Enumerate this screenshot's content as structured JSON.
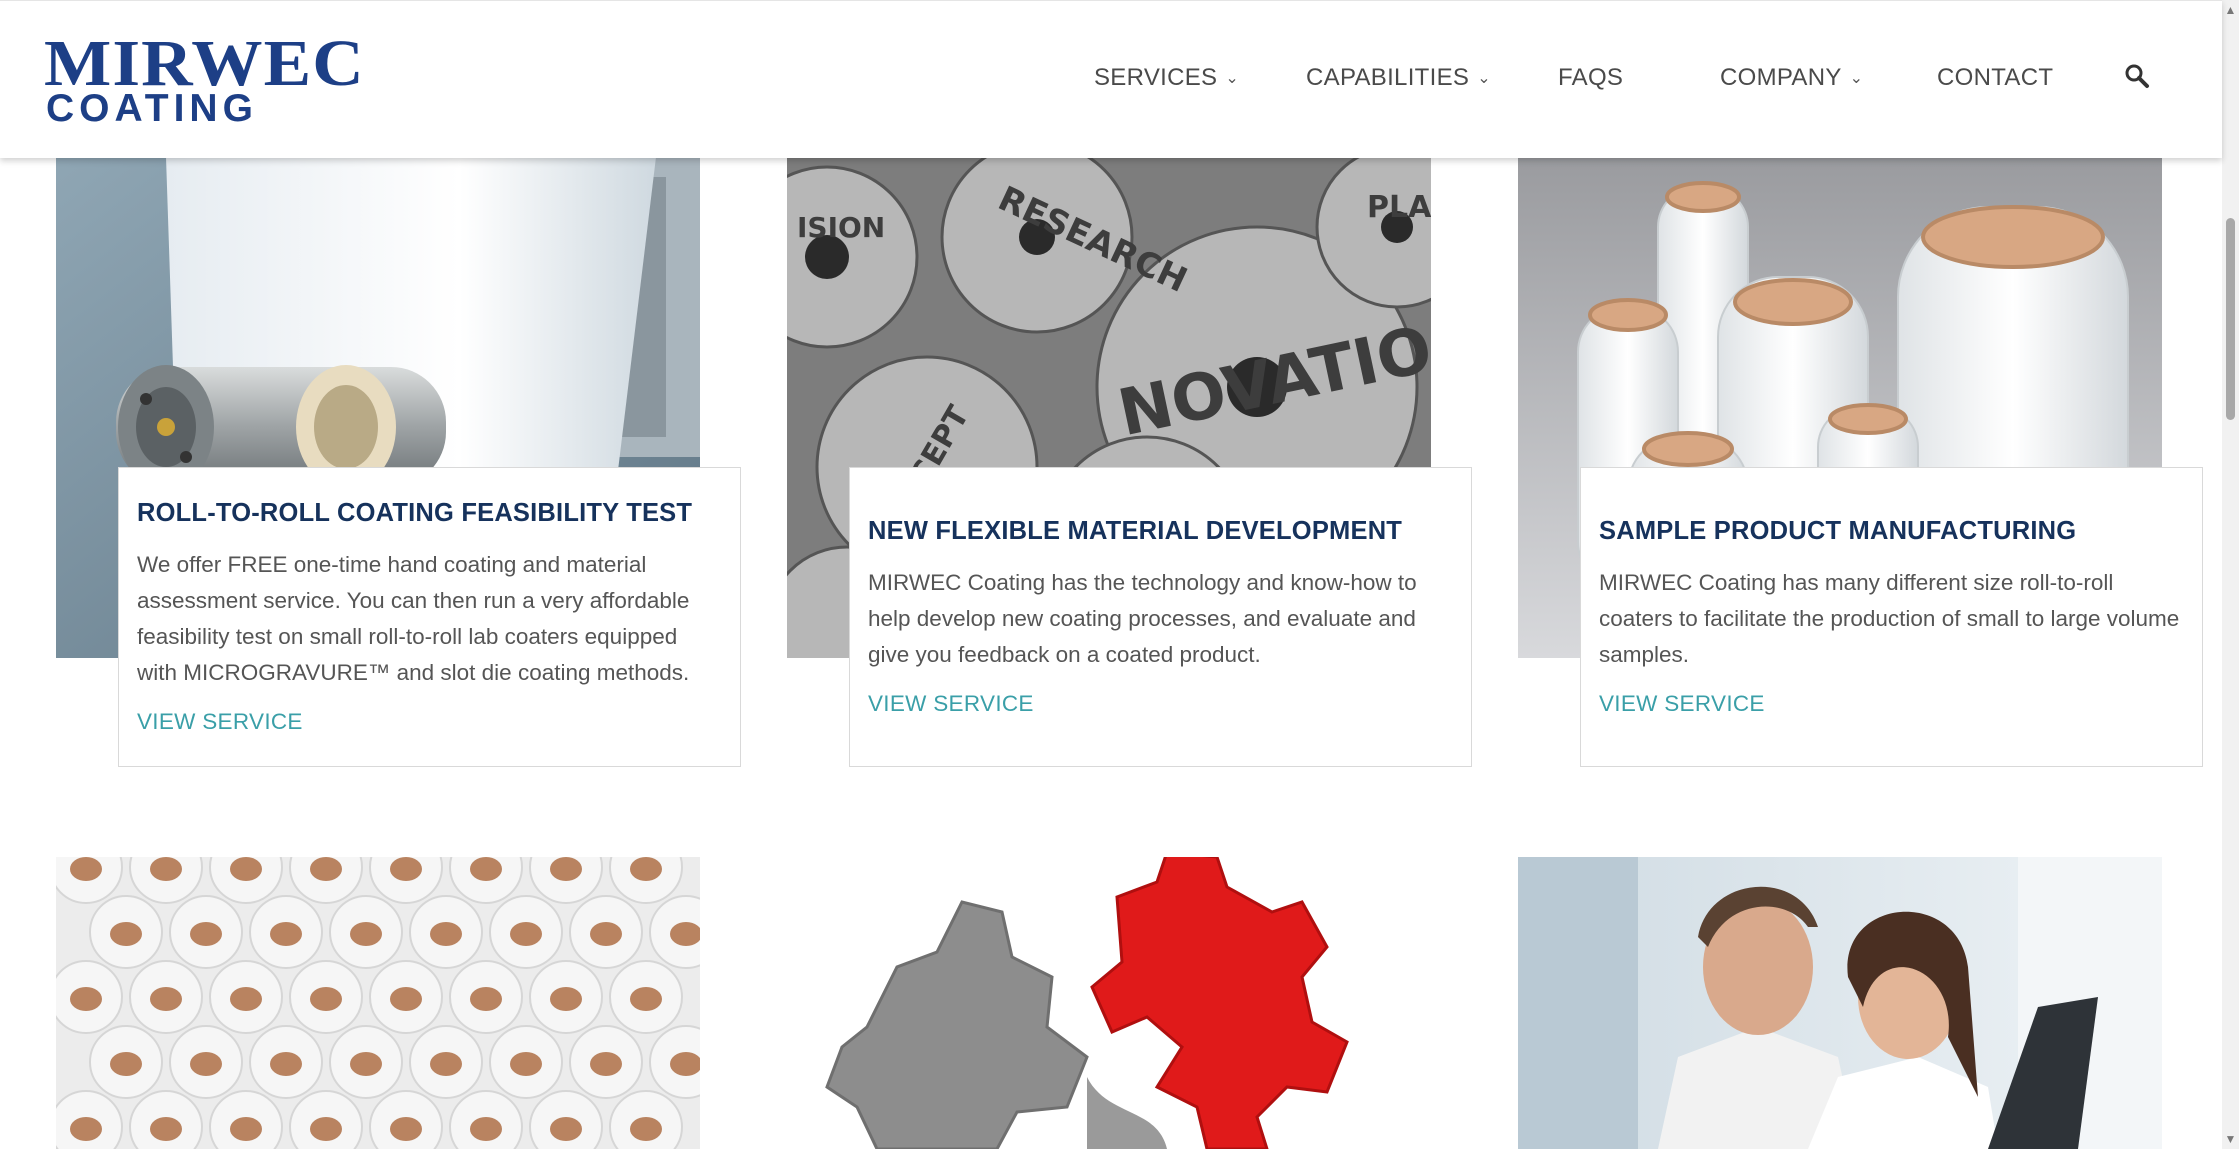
{
  "brand": {
    "line1": "MIRWEC",
    "line2": "COATING",
    "color": "#1d3f86"
  },
  "nav": {
    "items": [
      {
        "label": "SERVICES",
        "has_dropdown": true
      },
      {
        "label": "CAPABILITIES",
        "has_dropdown": true
      },
      {
        "label": "FAQS",
        "has_dropdown": false
      },
      {
        "label": "COMPANY",
        "has_dropdown": true
      },
      {
        "label": "CONTACT",
        "has_dropdown": false
      }
    ],
    "dropdown_glyph": "⌄",
    "search_icon": "search-icon"
  },
  "services": [
    {
      "title": "ROLL-TO-ROLL COATING FEASIBILITY TEST",
      "description": "We offer FREE one-time hand coating and material assessment service. You can then run a very affordable feasibility test on small roll-to-roll lab coaters equipped with MICROGRAVURE™ and slot die coating methods.",
      "link": "VIEW SERVICE",
      "image": "roll-to-roll-coater-photo"
    },
    {
      "title": "NEW FLEXIBLE MATERIAL DEVELOPMENT",
      "description": "MIRWEC Coating has the technology and know-how to help develop new coating processes, and evaluate and give you feedback on a coated product.",
      "link": "VIEW SERVICE",
      "image": "innovation-gears-photo"
    },
    {
      "title": "SAMPLE PRODUCT MANUFACTURING",
      "description": "MIRWEC Coating has many different size roll-to-roll coaters to facilitate the production of small to large volume samples.",
      "link": "VIEW SERVICE",
      "image": "film-rolls-photo"
    }
  ],
  "second_row_images": [
    "stacked-film-rolls-photo",
    "puzzle-gears-photo",
    "lab-scientists-photo"
  ],
  "colors": {
    "title": "#16325c",
    "link": "#3a9fa8",
    "text": "#555555"
  }
}
